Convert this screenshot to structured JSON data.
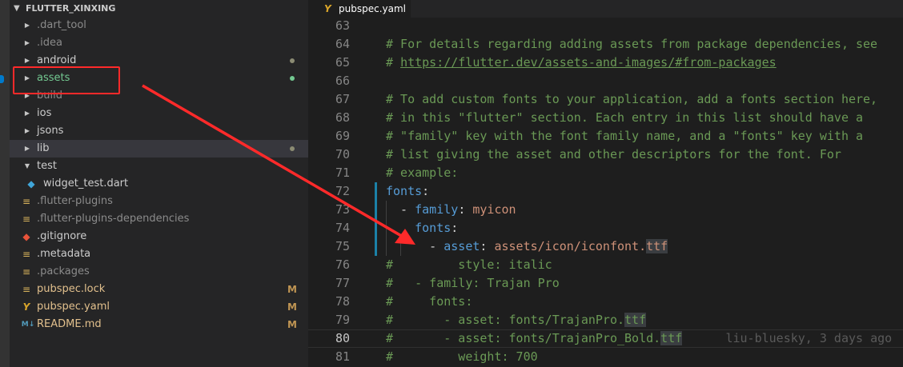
{
  "explorer": {
    "project_name": "FLUTTER_XINXING",
    "items": [
      {
        "name": ".dart_tool",
        "type": "folder-collapsed",
        "color": "#8b8b8b"
      },
      {
        "name": ".idea",
        "type": "folder-collapsed",
        "color": "#8b8b8b"
      },
      {
        "name": "android",
        "type": "folder-collapsed",
        "color": "#cccccc",
        "status": "dot",
        "status_color": "#8b8b73"
      },
      {
        "name": "assets",
        "type": "folder-collapsed",
        "color": "#73c991",
        "status": "dot",
        "status_color": "#73c991"
      },
      {
        "name": "build",
        "type": "folder-collapsed",
        "color": "#8b8b8b"
      },
      {
        "name": "ios",
        "type": "folder-collapsed",
        "color": "#cccccc"
      },
      {
        "name": "jsons",
        "type": "folder-collapsed",
        "color": "#cccccc"
      },
      {
        "name": "lib",
        "type": "folder-collapsed",
        "color": "#cccccc",
        "status": "dot",
        "status_color": "#8b8b73",
        "selected": true
      },
      {
        "name": "test",
        "type": "folder-expanded",
        "color": "#cccccc"
      },
      {
        "name": "widget_test.dart",
        "type": "file",
        "icon": "dart-file-icon",
        "glyph": "◆",
        "icon_color": "#40a6d9",
        "color": "#cccccc",
        "indent": 1
      },
      {
        "name": ".flutter-plugins",
        "type": "file",
        "icon": "text-file-icon",
        "glyph": "≡",
        "icon_color": "#d9b45c",
        "color": "#8b8b8b"
      },
      {
        "name": ".flutter-plugins-dependencies",
        "type": "file",
        "icon": "text-file-icon",
        "glyph": "≡",
        "icon_color": "#d9b45c",
        "color": "#8b8b8b"
      },
      {
        "name": ".gitignore",
        "type": "file",
        "icon": "git-file-icon",
        "glyph": "◆",
        "icon_color": "#e8533a",
        "color": "#cccccc"
      },
      {
        "name": ".metadata",
        "type": "file",
        "icon": "text-file-icon",
        "glyph": "≡",
        "icon_color": "#d9b45c",
        "color": "#cccccc"
      },
      {
        "name": ".packages",
        "type": "file",
        "icon": "text-file-icon",
        "glyph": "≡",
        "icon_color": "#d9b45c",
        "color": "#8b8b8b"
      },
      {
        "name": "pubspec.lock",
        "type": "file",
        "icon": "text-file-icon",
        "glyph": "≡",
        "icon_color": "#d9b45c",
        "color": "#e2c08d",
        "status": "M"
      },
      {
        "name": "pubspec.yaml",
        "type": "file",
        "icon": "yaml-file-icon",
        "glyph": "Y",
        "icon_color": "#d9a52a",
        "color": "#e2c08d",
        "status": "M"
      },
      {
        "name": "README.md",
        "type": "file",
        "icon": "markdown-file-icon",
        "glyph": "M↓",
        "icon_color": "#519aba",
        "color": "#e2c08d",
        "status": "M"
      }
    ]
  },
  "editor": {
    "tab": {
      "icon": "yaml-file-icon",
      "glyph": "Y",
      "label": "pubspec.yaml"
    },
    "lines": [
      {
        "n": "63",
        "seg": []
      },
      {
        "n": "64",
        "seg": [
          {
            "t": "# For details regarding adding assets from package dependencies, see",
            "c": "c-comment"
          }
        ]
      },
      {
        "n": "65",
        "seg": [
          {
            "t": "# ",
            "c": "c-comment"
          },
          {
            "t": "https://flutter.dev/assets-and-images/#from-packages",
            "c": "c-link"
          }
        ]
      },
      {
        "n": "66",
        "seg": []
      },
      {
        "n": "67",
        "seg": [
          {
            "t": "# To add custom fonts to your application, add a fonts section here,",
            "c": "c-comment"
          }
        ]
      },
      {
        "n": "68",
        "seg": [
          {
            "t": "# in this \"flutter\" section. Each entry in this list should have a",
            "c": "c-comment"
          }
        ]
      },
      {
        "n": "69",
        "seg": [
          {
            "t": "# \"family\" key with the font family name, and a \"fonts\" key with a",
            "c": "c-comment"
          }
        ]
      },
      {
        "n": "70",
        "seg": [
          {
            "t": "# list giving the asset and other descriptors for the font. For",
            "c": "c-comment"
          }
        ]
      },
      {
        "n": "71",
        "seg": [
          {
            "t": "# example:",
            "c": "c-comment"
          }
        ]
      },
      {
        "n": "72",
        "seg": [
          {
            "t": "fonts",
            "c": "c-key"
          },
          {
            "t": ":",
            "c": "c-dim"
          }
        ]
      },
      {
        "n": "73",
        "seg": [
          {
            "t": "  - ",
            "c": "c-dim"
          },
          {
            "t": "family",
            "c": "c-key"
          },
          {
            "t": ": ",
            "c": "c-dim"
          },
          {
            "t": "myicon",
            "c": "c-str"
          }
        ]
      },
      {
        "n": "74",
        "seg": [
          {
            "t": "    ",
            "c": "c-dim"
          },
          {
            "t": "fonts",
            "c": "c-key"
          },
          {
            "t": ":",
            "c": "c-dim"
          }
        ]
      },
      {
        "n": "75",
        "seg": [
          {
            "t": "      - ",
            "c": "c-dim"
          },
          {
            "t": "asset",
            "c": "c-key"
          },
          {
            "t": ": ",
            "c": "c-dim"
          },
          {
            "t": "assets/icon/iconfont.",
            "c": "c-str"
          },
          {
            "t": "ttf",
            "c": "c-hl-str"
          }
        ]
      },
      {
        "n": "76",
        "seg": [
          {
            "t": "#         style: italic",
            "c": "c-comment"
          }
        ]
      },
      {
        "n": "77",
        "seg": [
          {
            "t": "#   - family: Trajan Pro",
            "c": "c-comment"
          }
        ]
      },
      {
        "n": "78",
        "seg": [
          {
            "t": "#     fonts:",
            "c": "c-comment"
          }
        ]
      },
      {
        "n": "79",
        "seg": [
          {
            "t": "#       - asset: fonts/TrajanPro.",
            "c": "c-comment"
          },
          {
            "t": "ttf",
            "c": "c-hl"
          }
        ]
      },
      {
        "n": "80",
        "current": true,
        "seg": [
          {
            "t": "#       - asset: fonts/TrajanPro_Bold.",
            "c": "c-comment"
          },
          {
            "t": "ttf",
            "c": "c-hl"
          },
          {
            "t": "      liu-bluesky, 3 days ago",
            "c": "blame"
          }
        ]
      },
      {
        "n": "81",
        "seg": [
          {
            "t": "#         weight: 700",
            "c": "c-comment"
          }
        ]
      }
    ]
  },
  "annotation": {
    "color": "#ff2a2a"
  }
}
